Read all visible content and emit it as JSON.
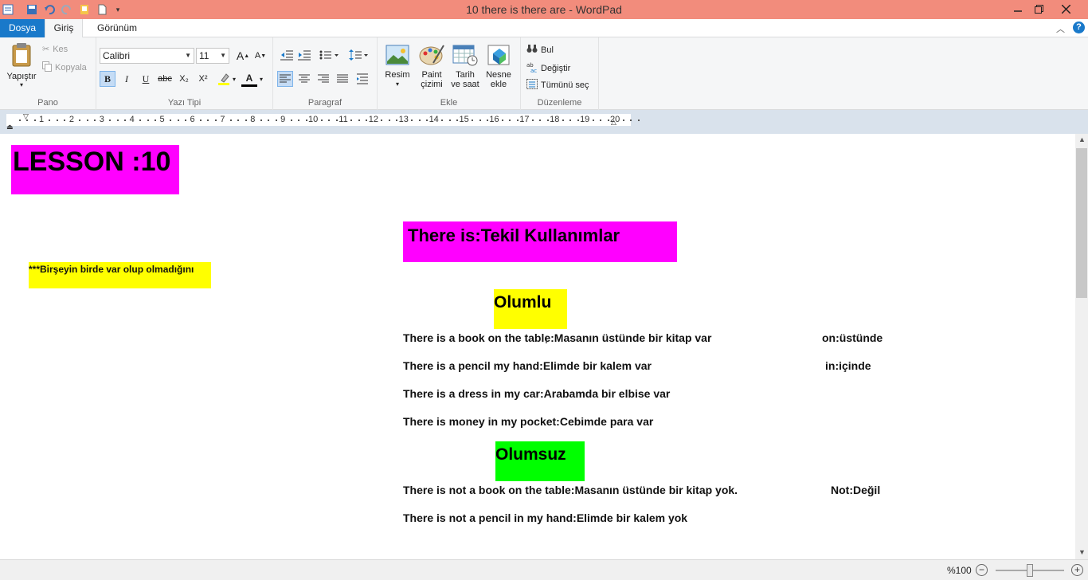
{
  "window": {
    "title": "10 there is  there are - WordPad"
  },
  "tabs": {
    "file": "Dosya",
    "home": "Giriş",
    "view": "Görünüm"
  },
  "ribbon": {
    "clipboard": {
      "paste": "Yapıştır",
      "cut": "Kes",
      "copy": "Kopyala",
      "label": "Pano"
    },
    "font": {
      "family": "Calibri",
      "size": "11",
      "label": "Yazı Tipi",
      "bold": "B",
      "italic": "I",
      "underline": "U",
      "strike": "abc",
      "subscript": "X₂",
      "superscript": "X²",
      "font_color_letter": "A",
      "grow": "A",
      "shrink": "A"
    },
    "paragraph": {
      "label": "Paragraf"
    },
    "insert": {
      "picture_line1": "Resim",
      "paint_line1": "Paint",
      "paint_line2": "çizimi",
      "datetime_line1": "Tarih",
      "datetime_line2": "ve saat",
      "object_line1": "Nesne",
      "object_line2": "ekle",
      "label": "Ekle"
    },
    "editing": {
      "find": "Bul",
      "replace": "Değiştir",
      "select_all": "Tümünü seç",
      "label": "Düzenleme"
    }
  },
  "ruler": {
    "numbers": [
      "1",
      "2",
      "3",
      "4",
      "5",
      "6",
      "7",
      "8",
      "9",
      "10",
      "11",
      "12",
      "13",
      "14",
      "15",
      "16",
      "17",
      "18",
      "19",
      "20"
    ]
  },
  "document": {
    "lesson": "LESSON :10",
    "heading": "There is:Tekil Kullanımlar",
    "note": "***Birşeyin birde var olup olmadığını",
    "olumlu": "Olumlu",
    "olumsuz": "Olumsuz",
    "lines": [
      "There is a book on the table:Masanın üstünde bir kitap var",
      "There is a pencil my hand:Elimde bir kalem var",
      "There is a dress in my car:Arabamda bir elbise var",
      "There is money in my pocket:Cebimde para var",
      "There is not  a book on the table:Masanın üstünde bir kitap yok.",
      "There is not a pencil in my hand:Elimde bir kalem yok"
    ],
    "side_notes": {
      "on": "on:üstünde",
      "in": "in:içinde",
      "not": "Not:Değil"
    },
    "colors": {
      "magenta": "#ff00ff",
      "yellow": "#ffff00",
      "green": "#00ff00"
    }
  },
  "statusbar": {
    "zoom": "%100",
    "zoom_out": "−",
    "zoom_in": "+"
  }
}
